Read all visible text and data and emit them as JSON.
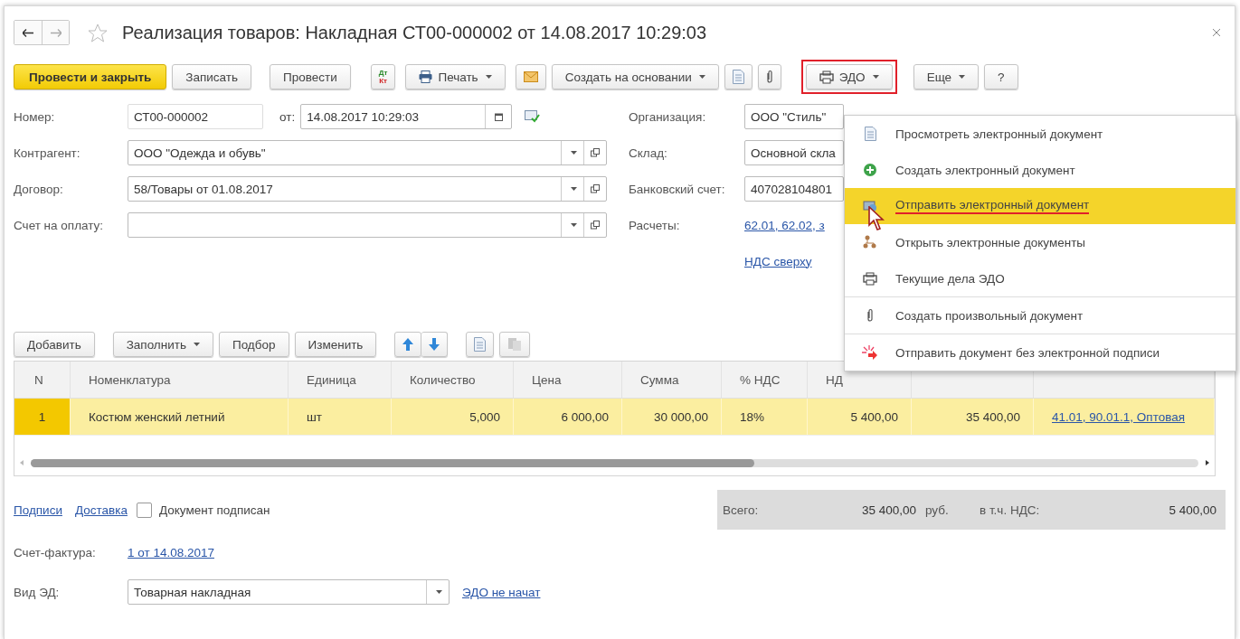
{
  "window": {
    "title": "Реализация товаров: Накладная СТ00-000002 от 14.08.2017 10:29:03",
    "favorite": false
  },
  "toolbar": [
    {
      "kind": "primary",
      "label": "Провести и закрыть"
    },
    {
      "kind": "text",
      "label": "Записать"
    },
    {
      "kind": "text",
      "label": "Провести"
    },
    {
      "kind": "dtkt",
      "top": "Дт",
      "bottom": "Кт"
    },
    {
      "kind": "print",
      "label": "Печать",
      "dropdown": true
    },
    {
      "kind": "mail"
    },
    {
      "kind": "text",
      "label": "Создать на основании",
      "dropdown": true
    },
    {
      "kind": "doc"
    },
    {
      "kind": "clip"
    },
    {
      "kind": "edo",
      "label": "ЭДО",
      "dropdown": true,
      "annotated": true
    },
    {
      "kind": "text",
      "label": "Еще",
      "dropdown": true
    },
    {
      "kind": "text",
      "label": "?"
    }
  ],
  "left_fields": [
    {
      "kind": "number",
      "label": "Номер:",
      "value": "СТ00-000002",
      "date_label": "от:",
      "date": "14.08.2017 10:29:03"
    },
    {
      "kind": "select",
      "label": "Контрагент:",
      "value": "ООО \"Одежда и обувь\""
    },
    {
      "kind": "select",
      "label": "Договор:",
      "value": "58/Товары от 01.08.2017"
    },
    {
      "kind": "select",
      "label": "Счет на оплату:"
    }
  ],
  "right_fields": [
    {
      "kind": "field",
      "label": "Организация:",
      "value": "ООО \"Стиль\""
    },
    {
      "kind": "field",
      "label": "Склад:",
      "value": "Основной скла"
    },
    {
      "kind": "field",
      "label": "Банковский счет:",
      "value": "407028104801"
    },
    {
      "kind": "link",
      "label": "Расчеты:",
      "value": "62.01, 62.02, з"
    },
    {
      "kind": "link",
      "value": "НДС сверху"
    }
  ],
  "table_toolbar": [
    {
      "kind": "text",
      "label": "Добавить"
    },
    {
      "kind": "text",
      "label": "Заполнить",
      "dropdown": true
    },
    {
      "kind": "text",
      "label": "Подбор"
    },
    {
      "kind": "text",
      "label": "Изменить"
    },
    {
      "kind": "up"
    },
    {
      "kind": "down"
    },
    {
      "kind": "copy"
    },
    {
      "kind": "paste"
    }
  ],
  "table": {
    "columns": [
      "N",
      "Номенклатура",
      "Единица",
      "Количество",
      "Цена",
      "Сумма",
      "% НДС",
      "НД"
    ],
    "rows": [
      {
        "selected": true,
        "cells": [
          "1",
          "Костюм женский летний",
          "шт",
          "5,000",
          "6 000,00",
          "30 000,00",
          "18%",
          "5 400,00",
          "35 400,00",
          "41.01, 90.01.1, Оптовая"
        ]
      }
    ]
  },
  "footer": {
    "links": [
      "Подписи",
      "Доставка"
    ],
    "checkbox": {
      "label": "Документ подписан",
      "checked": false
    },
    "totals": {
      "total_label": "Всего:",
      "total": "35 400,00",
      "currency": "руб.",
      "vat_label": "в т.ч. НДС:",
      "vat": "5 400,00"
    },
    "invoice": {
      "label": "Счет-фактура:",
      "value": "1 от 14.08.2017"
    },
    "ed_kind": {
      "label": "Вид ЭД:",
      "value": "Товарная накладная",
      "status": "ЭДО не начат"
    }
  },
  "menu": {
    "items": [
      {
        "label": "Просмотреть электронный документ",
        "selected": false,
        "underlined": false,
        "separator_before": false
      },
      {
        "label": "Создать электронный документ",
        "selected": false,
        "underlined": false,
        "separator_before": false
      },
      {
        "label": "Отправить электронный документ",
        "selected": true,
        "underlined": true,
        "separator_before": false
      },
      {
        "label": "Открыть электронные документы",
        "selected": false,
        "underlined": false,
        "separator_before": false
      },
      {
        "label": "Текущие дела ЭДО",
        "selected": false,
        "underlined": false,
        "separator_before": false
      },
      {
        "label": "Создать произвольный документ",
        "selected": false,
        "underlined": false,
        "separator_before": true
      },
      {
        "label": "Отправить документ без электронной подписи",
        "selected": false,
        "underlined": false,
        "separator_before": true
      }
    ]
  }
}
